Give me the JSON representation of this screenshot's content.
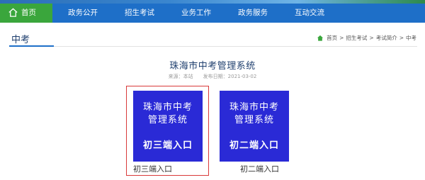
{
  "nav": {
    "home": "首页",
    "items": [
      "政务公开",
      "招生考试",
      "业务工作",
      "政务服务",
      "互动交流"
    ]
  },
  "section": {
    "title": "中考"
  },
  "breadcrumb": {
    "items": [
      "首页",
      "招生考试",
      "考试简介",
      "中考"
    ],
    "separator": ">"
  },
  "article": {
    "title": "珠海市中考管理系统",
    "source": "来源：本站",
    "date": "发布日期：2021-03-02"
  },
  "cards": [
    {
      "line1": "珠海市中考",
      "line2": "管理系统",
      "entry": "初三端入口",
      "caption": "初三端入口"
    },
    {
      "line1": "珠海市中考",
      "line2": "管理系统",
      "entry": "初二端入口",
      "caption": "初二端入口"
    }
  ],
  "colors": {
    "nav_bg": "#1e6fc8",
    "home_bg": "#3aa63c",
    "card_bg": "#2a2ad6",
    "highlight": "#d93a3a",
    "title_text": "#1f3f6e"
  },
  "icons": {
    "nav_home": "house-icon",
    "breadcrumb_home": "house-icon"
  }
}
